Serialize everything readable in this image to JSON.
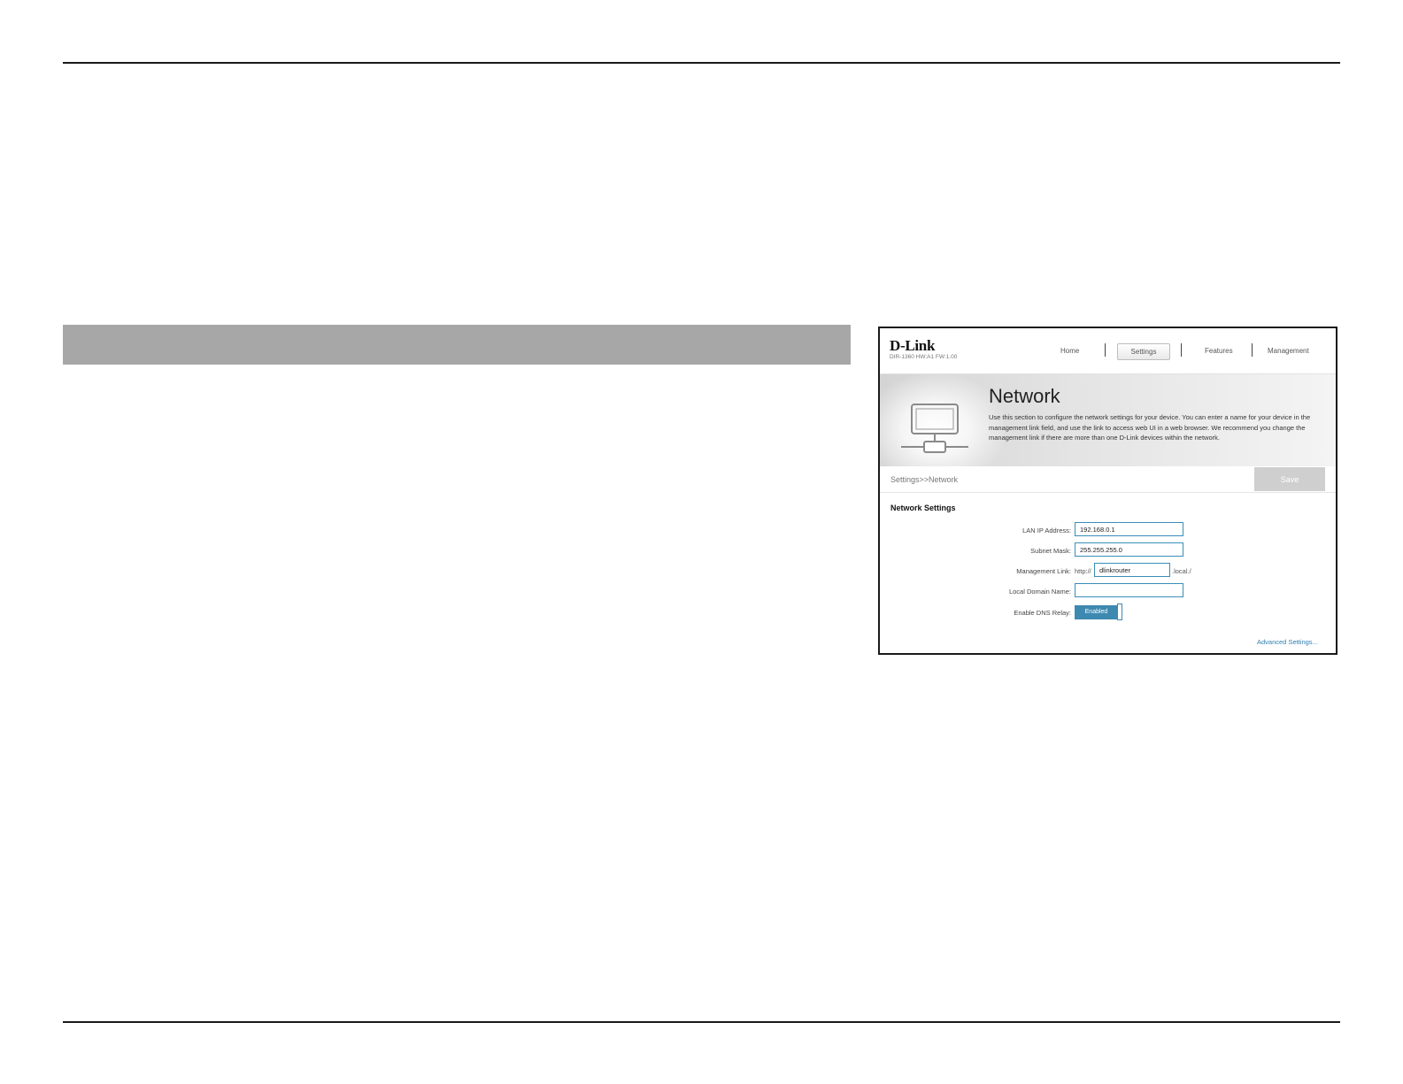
{
  "router": {
    "brand": "D-Link",
    "hw_info": "DIR-1360 HW:A1 FW:1.00",
    "nav": {
      "home": "Home",
      "settings": "Settings",
      "features": "Features",
      "management": "Management"
    },
    "banner": {
      "icon": "network-computer-icon",
      "title": "Network",
      "description": "Use this section to configure the network settings for your device. You can enter a name for your device in the management link field, and use the link to access web UI in a web browser. We recommend you change the management link if there are more than one D-Link devices within the network."
    },
    "breadcrumb": "Settings>>Network",
    "save_label": "Save",
    "section_title": "Network Settings",
    "fields": {
      "lan_ip_label": "LAN IP Address:",
      "lan_ip_value": "192.168.0.1",
      "subnet_label": "Subnet Mask:",
      "subnet_value": "255.255.255.0",
      "mgmt_label": "Management Link:",
      "mgmt_prefix": "http://",
      "mgmt_value": "dlinkrouter",
      "mgmt_suffix": ".local./",
      "domain_label": "Local Domain Name:",
      "domain_value": "",
      "dns_label": "Enable DNS Relay:",
      "dns_state": "Enabled"
    },
    "advanced_link": "Advanced Settings..."
  },
  "colors": {
    "accent": "#3d89b0",
    "link": "#2f7fb0",
    "save_button": "#cfcfcf",
    "header_bar": "#a7a7a7"
  }
}
